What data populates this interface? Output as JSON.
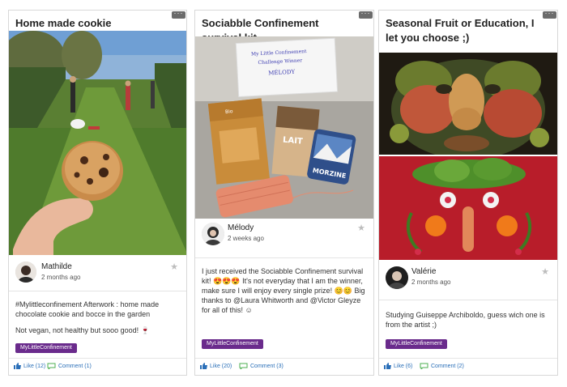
{
  "cards": [
    {
      "title": "Home made cookie",
      "author": "Mathilde",
      "date": "2 months ago",
      "body": [
        "#Mylittleconfinement Afterwork : home made chocolate cookie and bocce in the garden",
        "Not vegan, not healthy but sooo good! 🍷"
      ],
      "tag": "MyLittleConfinement",
      "like": "Like (12)",
      "comment": "Comment (1)"
    },
    {
      "title": "Sociabble Confinement survival kit",
      "author": "Mélody",
      "date": "2 weeks ago",
      "body": [
        "I just received the Sociabble Confinement survival kit! 😍😍😍 It's not everyday that I am the winner, make sure I will enjoy every single prize! 😊😊 Big thanks to @Laura Whitworth and @Victor Gleyze for all of this! ☺"
      ],
      "tag": "MyLittleConfinement",
      "like": "Like (20)",
      "comment": "Comment (3)",
      "note_text": [
        "My Little Confinement",
        "Challenge Winner",
        "MÉLODY"
      ],
      "box_labels": [
        "MORZINE",
        "LAIT",
        "Bio"
      ]
    },
    {
      "title": "Seasonal Fruit or Education, I let you choose ;)",
      "author": "Valérie",
      "date": "2 months ago",
      "body": [
        "Studying Guiseppe Archiboldo, guess wich one is from the artist ;)"
      ],
      "tag": "MyLittleConfinement",
      "like": "Like (6)",
      "comment": "Comment (2)"
    }
  ],
  "colors": {
    "tag": "#6a2b8c",
    "link": "#2a6fb8",
    "star": "#bdbdbd",
    "more": "#6b6b6b"
  },
  "icons": {
    "more": "more-icon",
    "star": "star-icon",
    "like": "thumbs-up-icon",
    "comment": "comment-icon"
  }
}
